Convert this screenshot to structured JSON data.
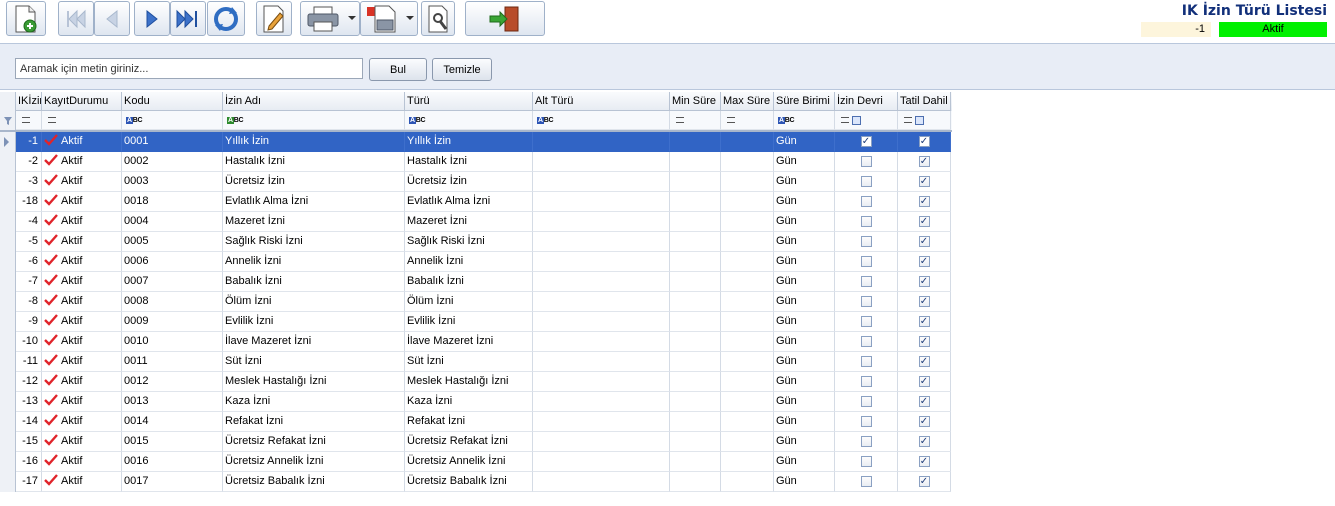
{
  "title": "IK İzin Türü Listesi",
  "status": {
    "id": "-1",
    "text": "Aktif"
  },
  "search": {
    "placeholder": "Aramak için metin giriniz...",
    "find_label": "Bul",
    "clear_label": "Temizle"
  },
  "toolbar": {
    "icons": [
      "add-icon",
      "first-record-icon",
      "previous-record-icon",
      "next-record-icon",
      "last-record-icon",
      "refresh-icon",
      "edit-icon",
      "print-icon",
      "pdf-export-icon",
      "settings-icon",
      "exit-icon"
    ]
  },
  "grid": {
    "columns": [
      "IKİzin",
      "KayıtDurumu",
      "Kodu",
      "İzin Adı",
      "Türü",
      "Alt Türü",
      "Min Süre",
      "Max Süre",
      "Süre Birimi",
      "İzin Devri",
      "Tatil Dahil"
    ],
    "rows": [
      {
        "id": "-1",
        "status": "Aktif",
        "code": "0001",
        "name": "Yıllık İzin",
        "type": "Yıllık İzin",
        "subtype": "",
        "min": "",
        "max": "",
        "unit": "Gün",
        "transfer": true,
        "holiday": true
      },
      {
        "id": "-2",
        "status": "Aktif",
        "code": "0002",
        "name": "Hastalık İzni",
        "type": "Hastalık İzni",
        "subtype": "",
        "min": "",
        "max": "",
        "unit": "Gün",
        "transfer": false,
        "holiday": true
      },
      {
        "id": "-3",
        "status": "Aktif",
        "code": "0003",
        "name": "Ücretsiz İzin",
        "type": "Ücretsiz İzin",
        "subtype": "",
        "min": "",
        "max": "",
        "unit": "Gün",
        "transfer": false,
        "holiday": true
      },
      {
        "id": "-18",
        "status": "Aktif",
        "code": "0018",
        "name": "Evlatlık Alma İzni",
        "type": "Evlatlık Alma İzni",
        "subtype": "",
        "min": "",
        "max": "",
        "unit": "Gün",
        "transfer": false,
        "holiday": true
      },
      {
        "id": "-4",
        "status": "Aktif",
        "code": "0004",
        "name": "Mazeret İzni",
        "type": "Mazeret İzni",
        "subtype": "",
        "min": "",
        "max": "",
        "unit": "Gün",
        "transfer": false,
        "holiday": true
      },
      {
        "id": "-5",
        "status": "Aktif",
        "code": "0005",
        "name": "Sağlık Riski İzni",
        "type": "Sağlık Riski İzni",
        "subtype": "",
        "min": "",
        "max": "",
        "unit": "Gün",
        "transfer": false,
        "holiday": true
      },
      {
        "id": "-6",
        "status": "Aktif",
        "code": "0006",
        "name": "Annelik İzni",
        "type": "Annelik İzni",
        "subtype": "",
        "min": "",
        "max": "",
        "unit": "Gün",
        "transfer": false,
        "holiday": true
      },
      {
        "id": "-7",
        "status": "Aktif",
        "code": "0007",
        "name": "Babalık İzni",
        "type": "Babalık İzni",
        "subtype": "",
        "min": "",
        "max": "",
        "unit": "Gün",
        "transfer": false,
        "holiday": true
      },
      {
        "id": "-8",
        "status": "Aktif",
        "code": "0008",
        "name": "Ölüm İzni",
        "type": "Ölüm İzni",
        "subtype": "",
        "min": "",
        "max": "",
        "unit": "Gün",
        "transfer": false,
        "holiday": true
      },
      {
        "id": "-9",
        "status": "Aktif",
        "code": "0009",
        "name": "Evlilik İzni",
        "type": "Evlilik İzni",
        "subtype": "",
        "min": "",
        "max": "",
        "unit": "Gün",
        "transfer": false,
        "holiday": true
      },
      {
        "id": "-10",
        "status": "Aktif",
        "code": "0010",
        "name": "İlave Mazeret İzni",
        "type": "İlave Mazeret İzni",
        "subtype": "",
        "min": "",
        "max": "",
        "unit": "Gün",
        "transfer": false,
        "holiday": true
      },
      {
        "id": "-11",
        "status": "Aktif",
        "code": "0011",
        "name": "Süt İzni",
        "type": "Süt İzni",
        "subtype": "",
        "min": "",
        "max": "",
        "unit": "Gün",
        "transfer": false,
        "holiday": true
      },
      {
        "id": "-12",
        "status": "Aktif",
        "code": "0012",
        "name": "Meslek Hastalığı İzni",
        "type": "Meslek Hastalığı İzni",
        "subtype": "",
        "min": "",
        "max": "",
        "unit": "Gün",
        "transfer": false,
        "holiday": true
      },
      {
        "id": "-13",
        "status": "Aktif",
        "code": "0013",
        "name": "Kaza İzni",
        "type": "Kaza İzni",
        "subtype": "",
        "min": "",
        "max": "",
        "unit": "Gün",
        "transfer": false,
        "holiday": true
      },
      {
        "id": "-14",
        "status": "Aktif",
        "code": "0014",
        "name": "Refakat İzni",
        "type": "Refakat İzni",
        "subtype": "",
        "min": "",
        "max": "",
        "unit": "Gün",
        "transfer": false,
        "holiday": true
      },
      {
        "id": "-15",
        "status": "Aktif",
        "code": "0015",
        "name": "Ücretsiz Refakat İzni",
        "type": "Ücretsiz Refakat İzni",
        "subtype": "",
        "min": "",
        "max": "",
        "unit": "Gün",
        "transfer": false,
        "holiday": true
      },
      {
        "id": "-16",
        "status": "Aktif",
        "code": "0016",
        "name": "Ücretsiz Annelik İzni",
        "type": "Ücretsiz Annelik İzni",
        "subtype": "",
        "min": "",
        "max": "",
        "unit": "Gün",
        "transfer": false,
        "holiday": true
      },
      {
        "id": "-17",
        "status": "Aktif",
        "code": "0017",
        "name": "Ücretsiz Babalık İzni",
        "type": "Ücretsiz Babalık İzni",
        "subtype": "",
        "min": "",
        "max": "",
        "unit": "Gün",
        "transfer": false,
        "holiday": true
      }
    ]
  },
  "colors": {
    "selection": "#3164c5",
    "status_active": "#00f000",
    "title": "#12307a",
    "check_mark": "#e0242b"
  }
}
